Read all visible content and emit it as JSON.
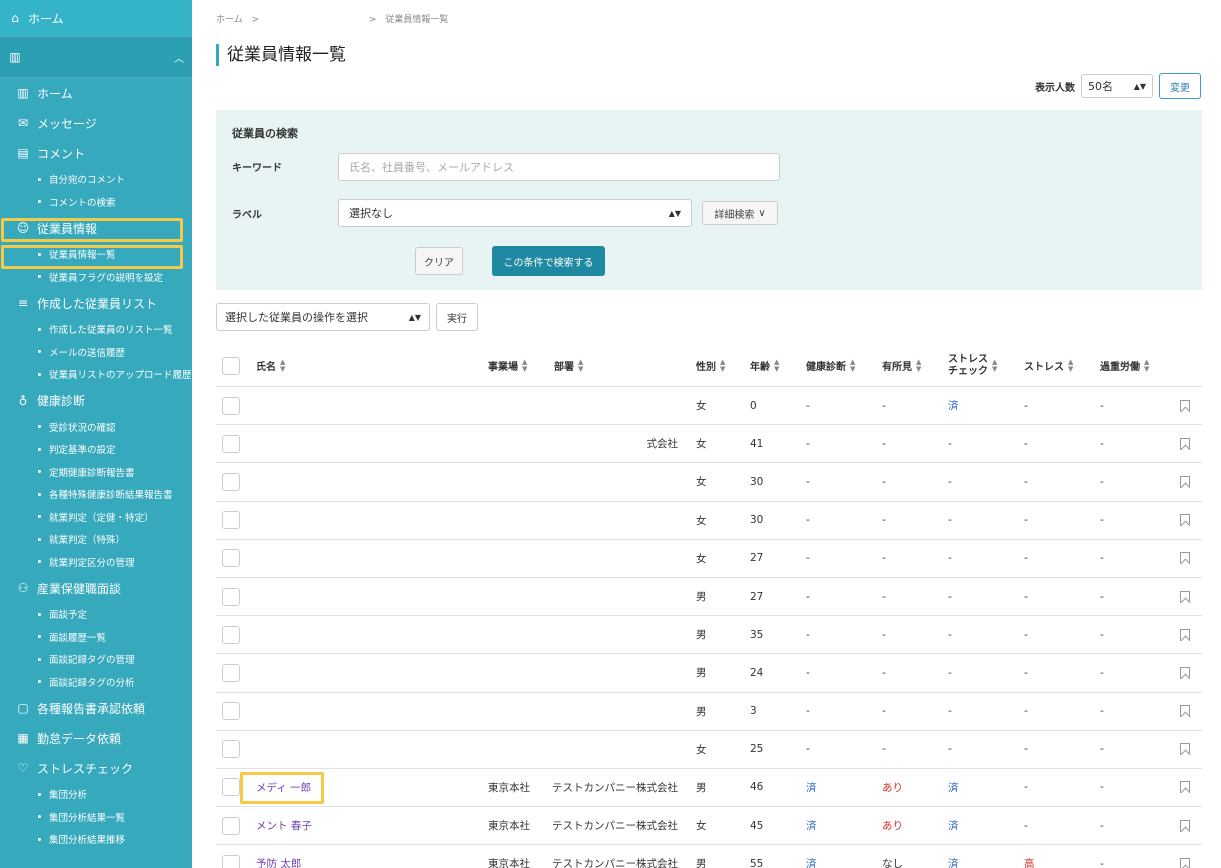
{
  "sidebar": {
    "home_top": "ホーム",
    "items": [
      {
        "icon": "building-icon",
        "label": "ホーム",
        "kind": "item"
      },
      {
        "icon": "mail-icon",
        "label": "メッセージ",
        "kind": "item"
      },
      {
        "icon": "comment-icon",
        "label": "コメント",
        "kind": "item"
      },
      {
        "label": "自分宛のコメント",
        "kind": "sub"
      },
      {
        "label": "コメントの検索",
        "kind": "sub"
      },
      {
        "icon": "people-icon",
        "label": "従業員情報",
        "kind": "item"
      },
      {
        "label": "従業員情報一覧",
        "kind": "sub"
      },
      {
        "label": "従業員フラグの説明を設定",
        "kind": "sub"
      },
      {
        "icon": "person-list-icon",
        "label": "作成した従業員リスト",
        "kind": "item"
      },
      {
        "label": "作成した従業員のリスト一覧",
        "kind": "sub"
      },
      {
        "label": "メールの送信履歴",
        "kind": "sub"
      },
      {
        "label": "従業員リストのアップロード履歴",
        "kind": "sub"
      },
      {
        "icon": "stethoscope-icon",
        "label": "健康診断",
        "kind": "item"
      },
      {
        "label": "受診状況の確認",
        "kind": "sub"
      },
      {
        "label": "判定基準の設定",
        "kind": "sub"
      },
      {
        "label": "定期健康診断報告書",
        "kind": "sub"
      },
      {
        "label": "各種特殊健康診断結果報告書",
        "kind": "sub"
      },
      {
        "label": "就業判定（定健・特定）",
        "kind": "sub"
      },
      {
        "label": "就業判定（特殊）",
        "kind": "sub"
      },
      {
        "label": "就業判定区分の管理",
        "kind": "sub"
      },
      {
        "icon": "meeting-icon",
        "label": "産業保健職面談",
        "kind": "item"
      },
      {
        "label": "面談予定",
        "kind": "sub"
      },
      {
        "label": "面談履歴一覧",
        "kind": "sub"
      },
      {
        "label": "面談記録タグの管理",
        "kind": "sub"
      },
      {
        "label": "面談記録タグの分析",
        "kind": "sub"
      },
      {
        "icon": "document-check-icon",
        "label": "各種報告書承認依頼",
        "kind": "item"
      },
      {
        "icon": "calendar-icon",
        "label": "勤怠データ依頼",
        "kind": "item"
      },
      {
        "icon": "heart-icon",
        "label": "ストレスチェック",
        "kind": "item"
      },
      {
        "label": "集団分析",
        "kind": "sub"
      },
      {
        "label": "集団分析結果一覧",
        "kind": "sub"
      },
      {
        "label": "集団分析結果推移",
        "kind": "sub"
      }
    ]
  },
  "breadcrumb": {
    "home": "ホーム",
    "sep": ">",
    "current": "従業員情報一覧"
  },
  "page_title": "従業員情報一覧",
  "perpage": {
    "label": "表示人数",
    "value": "50名",
    "button": "変更"
  },
  "search": {
    "heading": "従業員の検索",
    "keyword_label": "キーワード",
    "keyword_placeholder": "氏名、社員番号、メールアドレス",
    "label_label": "ラベル",
    "label_value": "選択なし",
    "detail_button": "詳細検索",
    "clear_button": "クリア",
    "submit_button": "この条件で検索する"
  },
  "bulk": {
    "select_value": "選択した従業員の操作を選択",
    "exec_button": "実行"
  },
  "table": {
    "headers": {
      "name": "氏名",
      "office": "事業場",
      "dept": "部署",
      "gender": "性別",
      "age": "年齢",
      "checkup": "健康診断",
      "finding": "有所見",
      "stress_check_1": "ストレス",
      "stress_check_2": "チェック",
      "stress": "ストレス",
      "overwork": "過重労働"
    },
    "rows": [
      {
        "name": "",
        "office": "",
        "dept": "",
        "gender": "女",
        "age": "0",
        "checkup": "-",
        "finding": "-",
        "stresscheck": "済",
        "stress": "-",
        "overwork": "-"
      },
      {
        "name": "",
        "office": "",
        "dept": "式会社",
        "gender": "女",
        "age": "41",
        "checkup": "-",
        "finding": "-",
        "stresscheck": "-",
        "stress": "-",
        "overwork": "-"
      },
      {
        "name": "",
        "office": "",
        "dept": "",
        "gender": "女",
        "age": "30",
        "checkup": "-",
        "finding": "-",
        "stresscheck": "-",
        "stress": "-",
        "overwork": "-"
      },
      {
        "name": "",
        "office": "",
        "dept": "",
        "gender": "女",
        "age": "30",
        "checkup": "-",
        "finding": "-",
        "stresscheck": "-",
        "stress": "-",
        "overwork": "-"
      },
      {
        "name": "",
        "office": "",
        "dept": "",
        "gender": "女",
        "age": "27",
        "checkup": "-",
        "finding": "-",
        "stresscheck": "-",
        "stress": "-",
        "overwork": "-"
      },
      {
        "name": "",
        "office": "",
        "dept": "",
        "gender": "男",
        "age": "27",
        "checkup": "-",
        "finding": "-",
        "stresscheck": "-",
        "stress": "-",
        "overwork": "-"
      },
      {
        "name": "",
        "office": "",
        "dept": "",
        "gender": "男",
        "age": "35",
        "checkup": "-",
        "finding": "-",
        "stresscheck": "-",
        "stress": "-",
        "overwork": "-"
      },
      {
        "name": "",
        "office": "",
        "dept": "",
        "gender": "男",
        "age": "24",
        "checkup": "-",
        "finding": "-",
        "stresscheck": "-",
        "stress": "-",
        "overwork": "-"
      },
      {
        "name": "",
        "office": "",
        "dept": "",
        "gender": "男",
        "age": "3",
        "checkup": "-",
        "finding": "-",
        "stresscheck": "-",
        "stress": "-",
        "overwork": "-"
      },
      {
        "name": "",
        "office": "",
        "dept": "",
        "gender": "女",
        "age": "25",
        "checkup": "-",
        "finding": "-",
        "stresscheck": "-",
        "stress": "-",
        "overwork": "-"
      },
      {
        "name": "メディ 一郎",
        "office": "東京本社",
        "dept": "テストカンパニー株式会社",
        "gender": "男",
        "age": "46",
        "checkup": "済",
        "finding": "あり",
        "stresscheck": "済",
        "stress": "-",
        "overwork": "-",
        "highlight": true
      },
      {
        "name": "メント 春子",
        "office": "東京本社",
        "dept": "テストカンパニー株式会社",
        "gender": "女",
        "age": "45",
        "checkup": "済",
        "finding": "あり",
        "stresscheck": "済",
        "stress": "-",
        "overwork": "-"
      },
      {
        "name": "予防 太郎",
        "office": "東京本社",
        "dept": "テストカンパニー株式会社",
        "gender": "男",
        "age": "55",
        "checkup": "済",
        "finding": "なし",
        "stresscheck": "済",
        "stress": "高",
        "overwork": "-"
      }
    ]
  },
  "colors": {
    "sidebar": "#36a9bd",
    "accent": "#34a7c4",
    "highlight": "#f7c948",
    "primary_button": "#1e89a0",
    "link": "#2a64c7",
    "alert": "#d9302c"
  }
}
